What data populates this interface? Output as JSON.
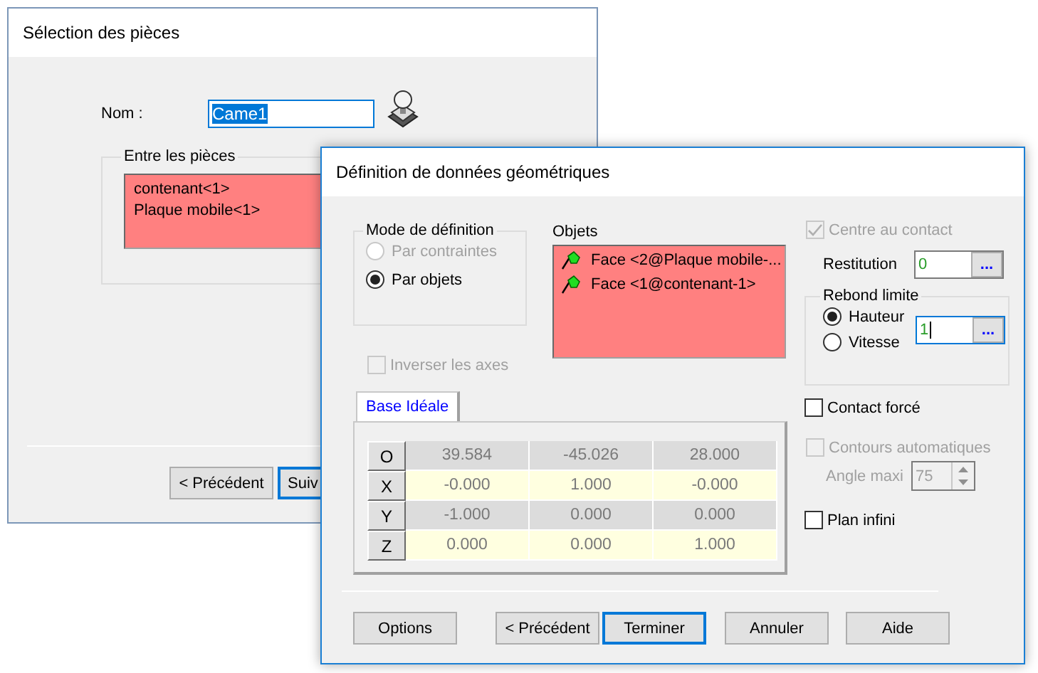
{
  "back_window": {
    "title": "Sélection des pièces",
    "name_label": "Nom :",
    "name_value": "Came1",
    "name_selected": true,
    "group": {
      "title": "Entre les pièces",
      "items": [
        "contenant<1>",
        "Plaque mobile<1>"
      ]
    },
    "buttons": [
      {
        "label": "< Précédent",
        "focused": false
      },
      {
        "label": "Suiv",
        "focused": true
      }
    ]
  },
  "front_window": {
    "title": "Définition de données géométriques",
    "mode": {
      "title": "Mode de définition",
      "options": [
        {
          "label": "Par contraintes",
          "selected": false,
          "disabled": true
        },
        {
          "label": "Par objets",
          "selected": true,
          "disabled": false
        }
      ]
    },
    "invert_axes": {
      "label": "Inverser les axes",
      "checked": false,
      "disabled": true
    },
    "objects": {
      "label": "Objets",
      "items": [
        "Face <2@Plaque mobile-...",
        "Face <1@contenant-1>"
      ]
    },
    "tabs": [
      {
        "label": "Base Idéale",
        "selected": true
      }
    ],
    "table": {
      "rows": [
        {
          "header": "O",
          "cells": [
            "39.584",
            "-45.026",
            "28.000"
          ]
        },
        {
          "header": "X",
          "cells": [
            "-0.000",
            "1.000",
            "-0.000"
          ]
        },
        {
          "header": "Y",
          "cells": [
            "-1.000",
            "0.000",
            "0.000"
          ]
        },
        {
          "header": "Z",
          "cells": [
            "0.000",
            "0.000",
            "1.000"
          ]
        }
      ]
    },
    "center_contact": {
      "label": "Centre au contact",
      "checked": true,
      "disabled": true
    },
    "restitution": {
      "label": "Restitution",
      "value": "0",
      "browse": "..."
    },
    "rebound": {
      "title": "Rebond limite",
      "options": [
        {
          "label": "Hauteur",
          "selected": true
        },
        {
          "label": "Vitesse",
          "selected": false
        }
      ],
      "value": "1",
      "browse": "..."
    },
    "forced_contact": {
      "label": "Contact forcé",
      "checked": false,
      "disabled": false
    },
    "auto_contours": {
      "label": "Contours automatiques",
      "checked": false,
      "disabled": true
    },
    "angle": {
      "label": "Angle maxi",
      "value": "75",
      "disabled": true
    },
    "infinite_plane": {
      "label": "Plan infini",
      "checked": false,
      "disabled": false
    },
    "buttons": [
      {
        "label": "Options",
        "focused": false
      },
      {
        "label": "< Précédent",
        "focused": false
      },
      {
        "label": "Terminer",
        "focused": true
      },
      {
        "label": "Annuler",
        "focused": false
      },
      {
        "label": "Aide",
        "focused": false
      }
    ]
  }
}
